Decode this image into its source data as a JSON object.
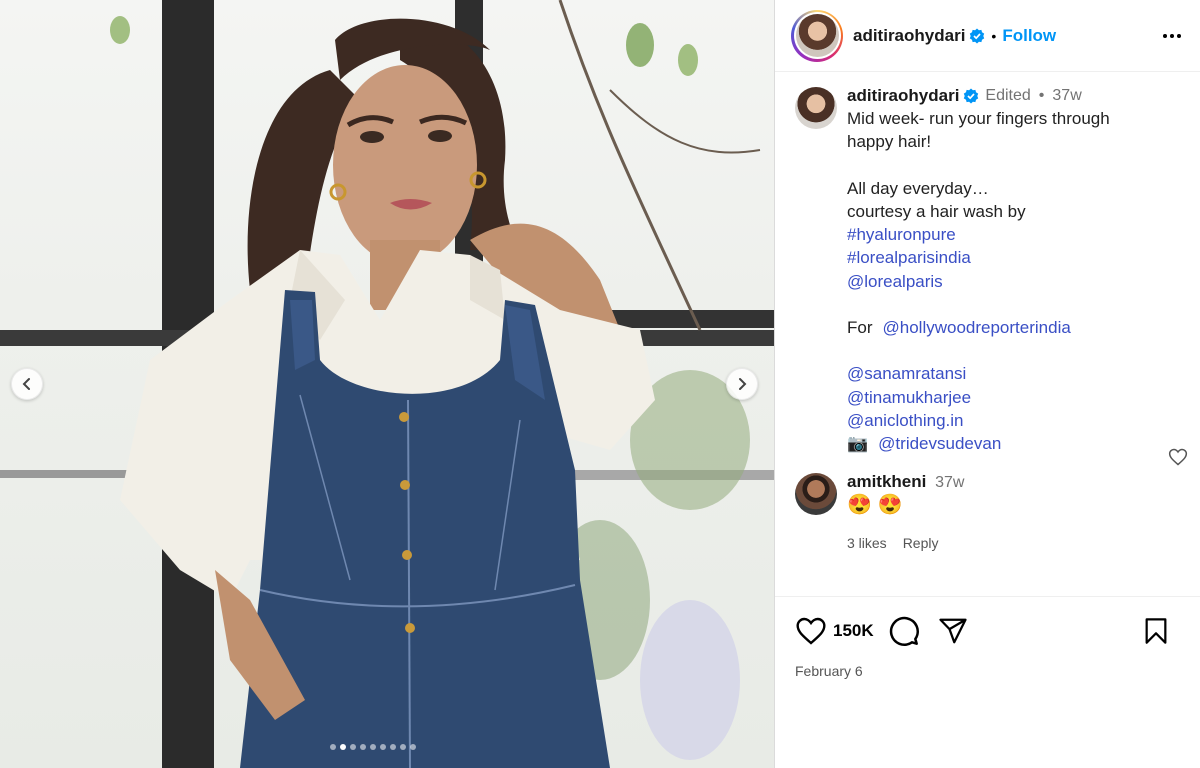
{
  "header": {
    "username": "aditiraohydari",
    "separator": "•",
    "follow_label": "Follow"
  },
  "caption": {
    "username": "aditiraohydari",
    "edited": "Edited",
    "separator": "•",
    "time": "37w",
    "lines": [
      {
        "text": "Mid week- run your fingers through",
        "type": "text"
      },
      {
        "text": "happy hair!",
        "type": "text"
      },
      {
        "text": "",
        "type": "blank"
      },
      {
        "text": "All day everyday…",
        "type": "text"
      },
      {
        "text": "courtesy a hair wash by",
        "type": "text"
      },
      {
        "text": "#hyaluronpure",
        "type": "link"
      },
      {
        "text": "#lorealparisindia",
        "type": "link"
      },
      {
        "text": "@lorealparis",
        "type": "link"
      },
      {
        "text": "",
        "type": "blank"
      },
      {
        "text": "For",
        "type": "text",
        "link": "@hollywoodreporterindia"
      },
      {
        "text": "",
        "type": "blank"
      },
      {
        "text": "@sanamratansi",
        "type": "link"
      },
      {
        "text": "@tinamukharjee",
        "type": "link"
      },
      {
        "text": "@aniclothing.in",
        "type": "link"
      },
      {
        "text": "📷",
        "type": "text",
        "link": "@tridevsudevan"
      }
    ]
  },
  "comment": {
    "username": "amitkheni",
    "time": "37w",
    "text": "😍 😍",
    "likes": "3 likes",
    "reply_label": "Reply"
  },
  "actions": {
    "likes_count": "150K",
    "date": "February 6"
  },
  "carousel": {
    "slide_count": 9,
    "active_index": 1
  },
  "colors": {
    "follow_blue": "#0095f6",
    "link_blue": "#3a4fc5",
    "verified_blue": "#0095f6"
  },
  "icons": [
    "verified-badge-icon",
    "more-options-icon",
    "heart-icon",
    "comment-icon",
    "share-icon",
    "bookmark-icon",
    "chevron-left-icon",
    "chevron-right-icon"
  ]
}
